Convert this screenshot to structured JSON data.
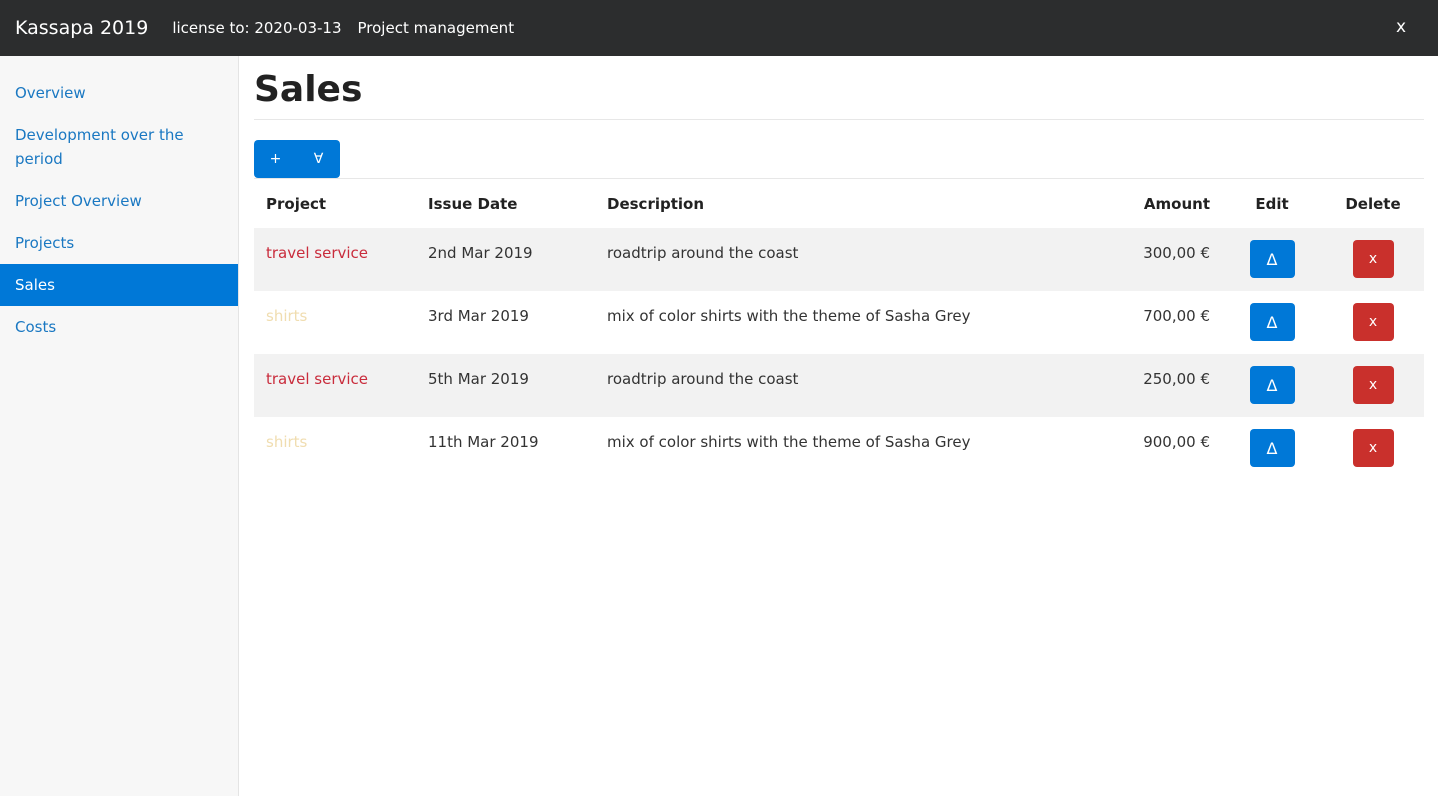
{
  "header": {
    "brand": "Kassapa 2019",
    "license": "license to: 2020-03-13",
    "module": "Project management",
    "close_label": "x"
  },
  "sidebar": {
    "items": [
      {
        "label": "Overview"
      },
      {
        "label": "Development over the period"
      },
      {
        "label": "Project Overview"
      },
      {
        "label": "Projects"
      },
      {
        "label": "Sales",
        "active": true
      },
      {
        "label": "Costs"
      }
    ]
  },
  "main": {
    "title": "Sales",
    "toolbar": {
      "add_label": "+",
      "select_all_label": "∀"
    },
    "table": {
      "columns": [
        "Project",
        "Issue Date",
        "Description",
        "Amount",
        "Edit",
        "Delete"
      ],
      "rows": [
        {
          "project": "travel service",
          "date": "2nd Mar 2019",
          "description": "roadtrip around the coast",
          "amount": "300,00 €",
          "edit": "Δ",
          "delete": "x"
        },
        {
          "project": "shirts",
          "date": "3rd Mar 2019",
          "description": "mix of color shirts with the theme of Sasha Grey",
          "amount": "700,00 €",
          "edit": "Δ",
          "delete": "x"
        },
        {
          "project": "travel service",
          "date": "5th Mar 2019",
          "description": "roadtrip around the coast",
          "amount": "250,00 €",
          "edit": "Δ",
          "delete": "x"
        },
        {
          "project": "shirts",
          "date": "11th Mar 2019",
          "description": "mix of color shirts with the theme of Sasha Grey",
          "amount": "900,00 €",
          "edit": "Δ",
          "delete": "x"
        }
      ]
    }
  },
  "colors": {
    "accent": "#0078d7",
    "danger": "#c9302c",
    "project_travel": "#c92c3c",
    "project_shirts": "#f0ddb0"
  }
}
